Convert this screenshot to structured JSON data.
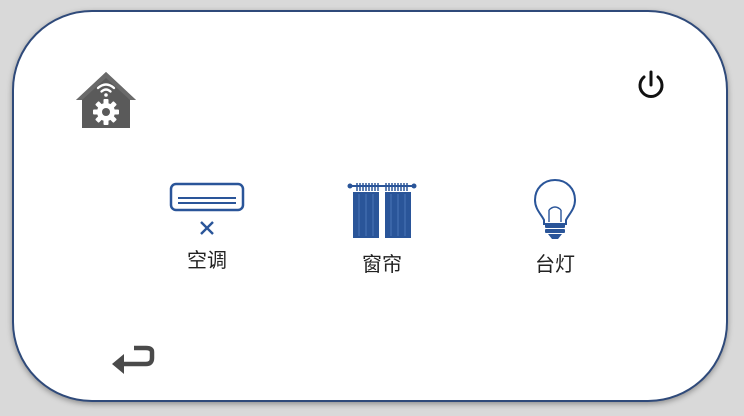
{
  "header": {
    "home_icon": "smart-home-gear-icon",
    "power_icon": "power-icon"
  },
  "devices": [
    {
      "label": "空调",
      "icon": "air-conditioner-icon",
      "status_icon": "close-x-icon"
    },
    {
      "label": "窗帘",
      "icon": "curtain-icon"
    },
    {
      "label": "台灯",
      "icon": "light-bulb-icon"
    }
  ],
  "footer": {
    "back_icon": "return-arrow-icon"
  },
  "colors": {
    "accent": "#2a5599",
    "border": "#2f4a7a",
    "icon_dark": "#555555",
    "text": "#222222"
  }
}
